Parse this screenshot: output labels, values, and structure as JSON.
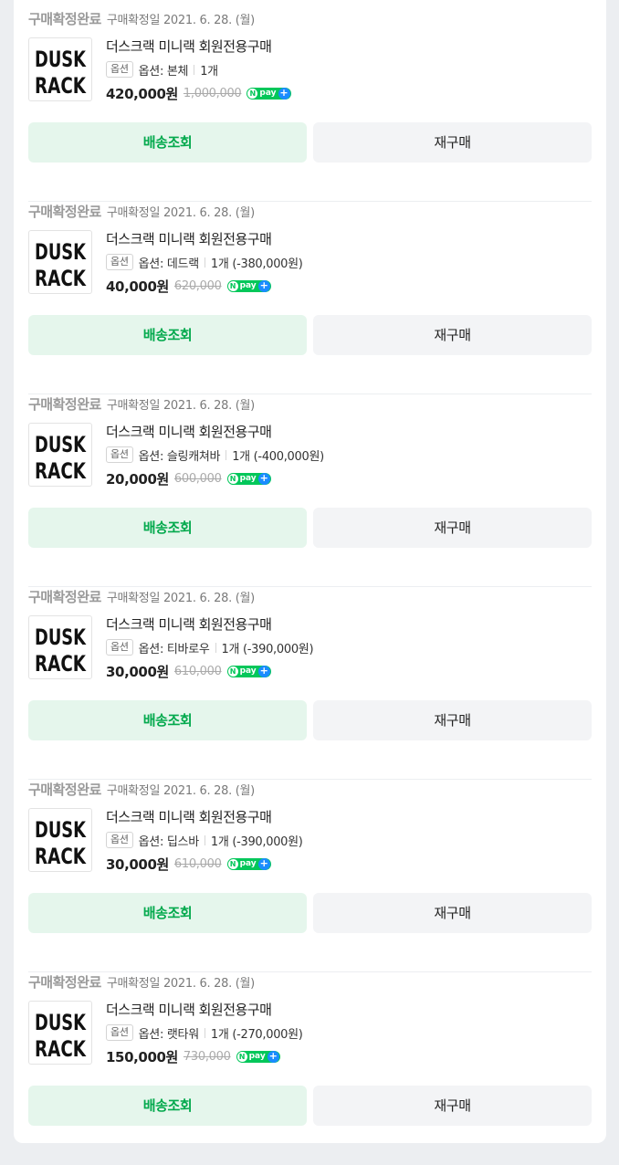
{
  "labels": {
    "option_badge": "옵션",
    "track_button": "배송조회",
    "rebuy_button": "재구매",
    "npay_n": "N",
    "npay_text": "pay",
    "npay_plus": "+",
    "logo_line1": "DUSK",
    "logo_line2": "RACK"
  },
  "colors": {
    "status_gray": "#9a9a9a",
    "track_bg": "#e5f6ec",
    "track_text": "#03a94d",
    "npay_green": "#03c75a",
    "npay_blue": "#1a8cff"
  },
  "orders": [
    {
      "status": "구매확정완료",
      "date": "구매확정일 2021. 6. 28. (월)",
      "title": "더스크랙 미니랙 회원전용구매",
      "option": "옵션: 본체",
      "qty": "1개",
      "price": "420,000원",
      "original_price": "1,000,000"
    },
    {
      "status": "구매확정완료",
      "date": "구매확정일 2021. 6. 28. (월)",
      "title": "더스크랙 미니랙 회원전용구매",
      "option": "옵션: 데드랙",
      "qty": "1개 (-380,000원)",
      "price": "40,000원",
      "original_price": "620,000"
    },
    {
      "status": "구매확정완료",
      "date": "구매확정일 2021. 6. 28. (월)",
      "title": "더스크랙 미니랙 회원전용구매",
      "option": "옵션: 슬링캐쳐바",
      "qty": "1개 (-400,000원)",
      "price": "20,000원",
      "original_price": "600,000"
    },
    {
      "status": "구매확정완료",
      "date": "구매확정일 2021. 6. 28. (월)",
      "title": "더스크랙 미니랙 회원전용구매",
      "option": "옵션: 티바로우",
      "qty": "1개 (-390,000원)",
      "price": "30,000원",
      "original_price": "610,000"
    },
    {
      "status": "구매확정완료",
      "date": "구매확정일 2021. 6. 28. (월)",
      "title": "더스크랙 미니랙 회원전용구매",
      "option": "옵션: 딥스바",
      "qty": "1개 (-390,000원)",
      "price": "30,000원",
      "original_price": "610,000"
    },
    {
      "status": "구매확정완료",
      "date": "구매확정일 2021. 6. 28. (월)",
      "title": "더스크랙 미니랙 회원전용구매",
      "option": "옵션: 랫타워",
      "qty": "1개 (-270,000원)",
      "price": "150,000원",
      "original_price": "730,000"
    }
  ]
}
